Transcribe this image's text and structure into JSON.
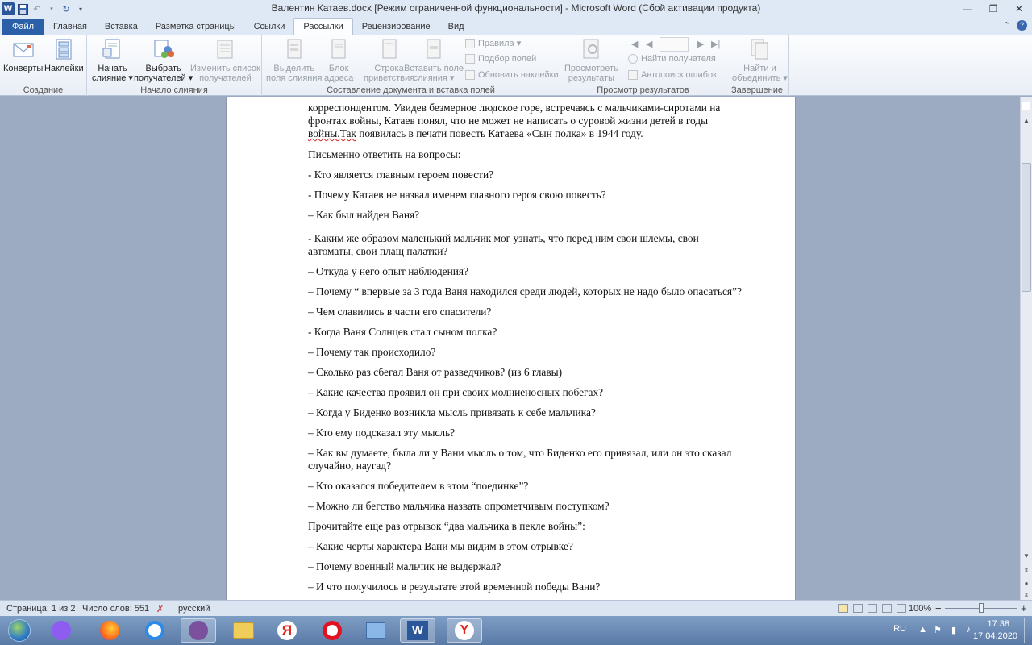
{
  "window": {
    "title": "Валентин Катаев.docx [Режим ограниченной функциональности]  -  Microsoft Word (Сбой активации продукта)",
    "app_logo": "W",
    "controls": {
      "minimize": "—",
      "maximize": "❐",
      "close": "✕"
    }
  },
  "qat": {
    "save_icon": "💾",
    "undo_icon": "↶",
    "redo_icon": "↻",
    "more_icon": "▾"
  },
  "tabs": [
    "Файл",
    "Главная",
    "Вставка",
    "Разметка страницы",
    "Ссылки",
    "Рассылки",
    "Рецензирование",
    "Вид"
  ],
  "active_tab": "Рассылки",
  "ribbon": {
    "groups": {
      "create": "Создание",
      "start_merge": "Начало слияния",
      "compose": "Составление документа и вставка полей",
      "preview": "Просмотр результатов",
      "finish": "Завершение"
    },
    "envelopes": "Конверты",
    "labels": "Наклейки",
    "start_merge_l1": "Начать",
    "start_merge_l2": "слияние ▾",
    "select_recipients_l1": "Выбрать",
    "select_recipients_l2": "получателей ▾",
    "edit_list_l1": "Изменить список",
    "edit_list_l2": "получателей",
    "highlight_l1": "Выделить",
    "highlight_l2": "поля слияния",
    "address_l1": "Блок",
    "address_l2": "адреса",
    "greeting_l1": "Строка",
    "greeting_l2": "приветствия",
    "insert_field_l1": "Вставить поле",
    "insert_field_l2": "слияния ▾",
    "rules": "Правила ▾",
    "match_fields": "Подбор полей",
    "update_labels": "Обновить наклейки",
    "preview_l1": "Просмотреть",
    "preview_l2": "результаты",
    "find_recipient": "Найти получателя",
    "auto_check": "Автопоиск ошибок",
    "finish_l1": "Найти и",
    "finish_l2": "объединить ▾"
  },
  "document": {
    "intro_before": "корреспондентом. Увидев безмерное людское горе, встречаясь с мальчиками-сиротами на фронтах войны, Катаев понял, что не может не написать о суровой жизни детей в годы ",
    "intro_underlined": "войны.Так",
    "intro_after": " появилась в печати повесть Катаева «Сын полка» в 1944 году.",
    "paragraphs": [
      "Письменно ответить на  вопросы:",
      "- Кто является главным героем повести?",
      "- Почему Катаев не назвал именем главного героя свою повесть?",
      "– Как был найден Ваня?",
      "-  Каким же образом маленький мальчик мог узнать, что перед ним свои шлемы, свои автоматы, свои плащ палатки?",
      "– Откуда у него опыт наблюдения?",
      "– Почему “ впервые за 3 года Ваня находился среди людей, которых не надо было опасаться”?",
      "– Чем славились в части его спасители?",
      "-  Когда Ваня Солнцев стал сыном полка?",
      "– Почему так происходило?",
      "– Сколько раз сбегал Ваня от разведчиков? (из 6 главы)",
      "– Какие качества проявил он при своих молниеносных побегах?",
      "– Когда у Биденко возникла мысль привязать к себе мальчика?",
      "– Кто ему подсказал эту мысль?",
      "– Как вы думаете, была ли у Вани мысль о том, что Биденко его привязал, или он это сказал случайно, наугад?",
      "– Кто оказался победителем в этом “поединке”?",
      "– Можно ли бегство мальчика назвать опрометчивым поступком?",
      " Прочитайте еще раз отрывок “два мальчика в пекле войны”:",
      "– Какие черты характера Вани мы видим в этом отрывке?",
      "– Почему военный мальчик не выдержал?",
      "– И что получилось в результате этой временной победы Вани?"
    ]
  },
  "status": {
    "page": "Страница: 1 из 2",
    "words": "Число слов: 551",
    "language": "русский",
    "zoom": "100%",
    "zoom_minus": "−",
    "zoom_plus": "+"
  },
  "taskbar": {
    "lang": "RU",
    "time": "17:38",
    "date": "17.04.2020",
    "yandex_letter": "Я"
  }
}
